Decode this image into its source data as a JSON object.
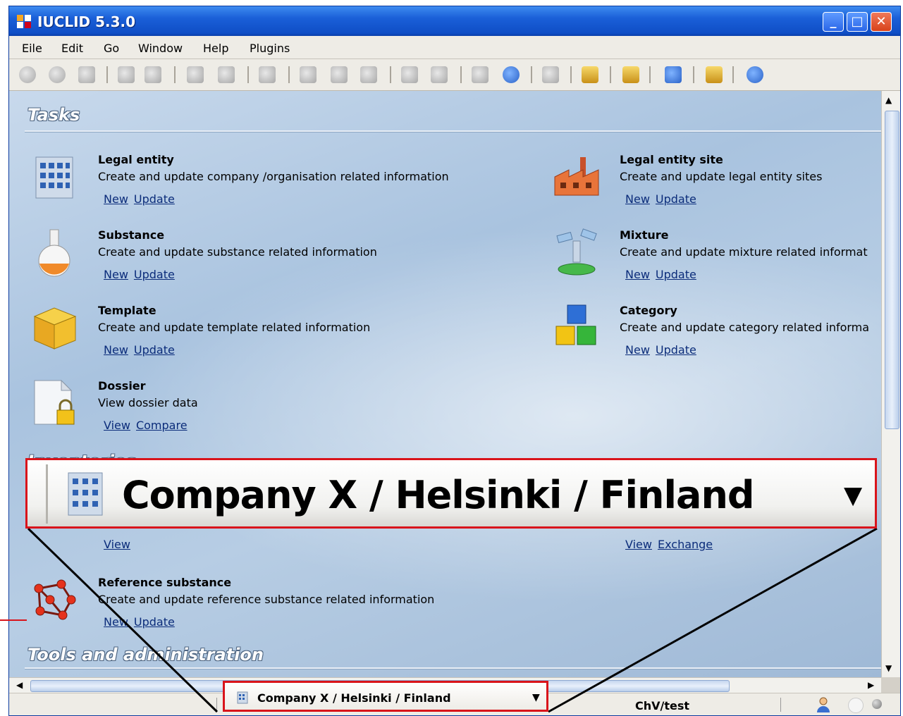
{
  "window": {
    "title": "IUCLID 5.3.0"
  },
  "menu": [
    "Eile",
    "Edit",
    "Go",
    "Window",
    "Help",
    "Plugins"
  ],
  "sections": {
    "tasks": "Tasks",
    "inventories": "Inventories",
    "tools": "Tools and administration"
  },
  "tasks": [
    {
      "name": "Legal entity",
      "desc": "Create and update company /organisation related information",
      "links": [
        "New",
        "Update"
      ]
    },
    {
      "name": "Legal entity site",
      "desc": "Create and update legal entity sites",
      "links": [
        "New",
        "Update"
      ]
    },
    {
      "name": "Substance",
      "desc": "Create and update substance related information",
      "links": [
        "New",
        "Update"
      ]
    },
    {
      "name": "Mixture",
      "desc": "Create and update mixture related informat",
      "links": [
        "New",
        "Update"
      ]
    },
    {
      "name": "Template",
      "desc": "Create and update template related information",
      "links": [
        "New",
        "Update"
      ]
    },
    {
      "name": "Category",
      "desc": "Create and update category related informa",
      "links": [
        "New",
        "Update"
      ]
    },
    {
      "name": "Dossier",
      "desc": "View dossier data",
      "links": [
        "View",
        "Compare"
      ]
    }
  ],
  "inventories": {
    "left_links": [
      "View"
    ],
    "right_links": [
      "View",
      "Exchange"
    ],
    "reference": {
      "name": "Reference substance",
      "desc": "Create and update reference substance related information",
      "links": [
        "New",
        "Update"
      ]
    }
  },
  "status": {
    "location": "Company X / Helsinki / Finland",
    "user": "ChV/test"
  },
  "zoom_callout": {
    "text": "Company X / Helsinki / Finland"
  },
  "colors": {
    "highlight": "#d9141b",
    "title_bar": "#1a5fd8",
    "link": "#0b2c7a"
  }
}
